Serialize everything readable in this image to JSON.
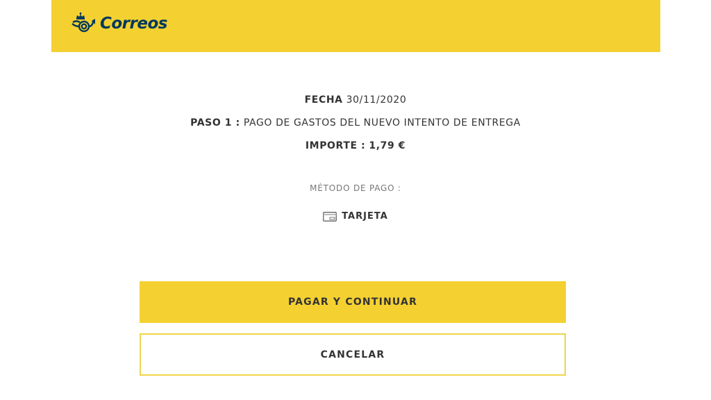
{
  "header": {
    "brand": "Correos",
    "brand_color": "#00385d",
    "background_color": "#f4d131",
    "logo_icon": "correos-horn-crown-icon"
  },
  "payment": {
    "fecha_label": "FECHA",
    "fecha_value": "30/11/2020",
    "paso_label": "PASO 1 :",
    "paso_value": "PAGO DE GASTOS DEL NUEVO INTENTO DE ENTREGA",
    "importe_label": "IMPORTE :",
    "importe_value": "1,79 €",
    "metodo_label": "MÉTODO DE PAGO :",
    "metodo_icon": "credit-card-icon",
    "metodo_value": "TARJETA"
  },
  "actions": {
    "pay_label": "PAGAR Y CONTINUAR",
    "cancel_label": "CANCELAR",
    "accent_color": "#f4d131"
  }
}
